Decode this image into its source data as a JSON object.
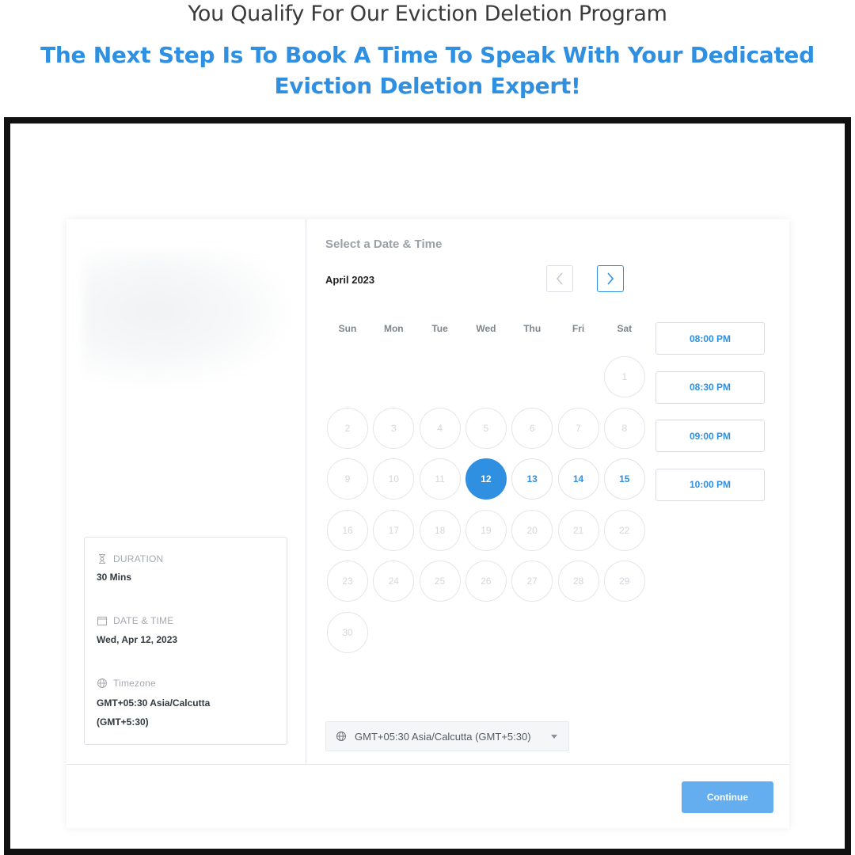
{
  "hero": {
    "subtitle": "You Qualify For Our Eviction Deletion Program",
    "title": "The Next Step Is To Book A Time To Speak With Your Dedicated Eviction Deletion Expert!"
  },
  "details": {
    "duration_label": "DURATION",
    "duration_value": "30 Mins",
    "datetime_label": "DATE & TIME",
    "datetime_value": "Wed, Apr 12, 2023",
    "timezone_label": "Timezone",
    "timezone_value_line1": "GMT+05:30 Asia/Calcutta",
    "timezone_value_line2": "(GMT+5:30)",
    "icons": [
      "hourglass-icon",
      "calendar-icon",
      "globe-icon"
    ]
  },
  "calendar": {
    "section_title": "Select a Date & Time",
    "month": "April 2023",
    "prev_icon": "chevron-left-icon",
    "next_icon": "chevron-right-icon",
    "weekdays": [
      "Sun",
      "Mon",
      "Tue",
      "Wed",
      "Thu",
      "Fri",
      "Sat"
    ],
    "first_weekday_index": 6,
    "days_in_month": 30,
    "available_days": [
      12,
      13,
      14,
      15
    ],
    "selected_day": 12
  },
  "time_slots": [
    "08:00 PM",
    "08:30 PM",
    "09:00 PM",
    "10:00 PM"
  ],
  "timezone_select": {
    "value": "GMT+05:30 Asia/Calcutta (GMT+5:30)"
  },
  "footer": {
    "continue_label": "Continue"
  },
  "colors": {
    "accent": "#2f8fe0",
    "button": "#64aef0",
    "frame": "#111111"
  }
}
